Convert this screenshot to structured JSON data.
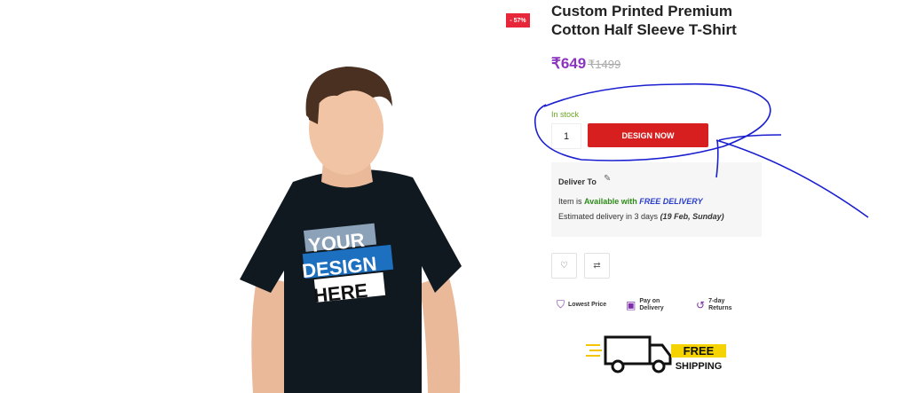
{
  "product": {
    "discount_badge": "- 57%",
    "title_line1": "Custom Printed Premium",
    "title_line2": "Cotton Half Sleeve T-Shirt",
    "price": "₹649",
    "old_price": "₹1499",
    "stock_status": "In stock",
    "quantity": "1",
    "design_button": "DESIGN NOW",
    "shirt_print": {
      "line1": "YOUR",
      "line2": "DESIGN",
      "line3": "HERE"
    }
  },
  "delivery": {
    "title": "Deliver To",
    "item_prefix": "Item is ",
    "available": "Available with",
    "free_delivery": "FREE DELIVERY",
    "estimate_prefix": "Estimated delivery in 3 days ",
    "estimate_date": "(19 Feb, Sunday)"
  },
  "features": [
    {
      "label1": "Lowest Price",
      "label2": "",
      "icon": "tag-icon"
    },
    {
      "label1": "Pay on",
      "label2": "Delivery",
      "icon": "cash-icon"
    },
    {
      "label1": "7-day",
      "label2": "Returns",
      "icon": "return-icon"
    }
  ],
  "shipping_banner": {
    "line1": "FREE",
    "line2": "SHIPPING"
  },
  "colors": {
    "accent": "#d71f1f",
    "price": "#8a34c0",
    "badge": "#e8263a",
    "annotation": "#1a1fcf"
  }
}
